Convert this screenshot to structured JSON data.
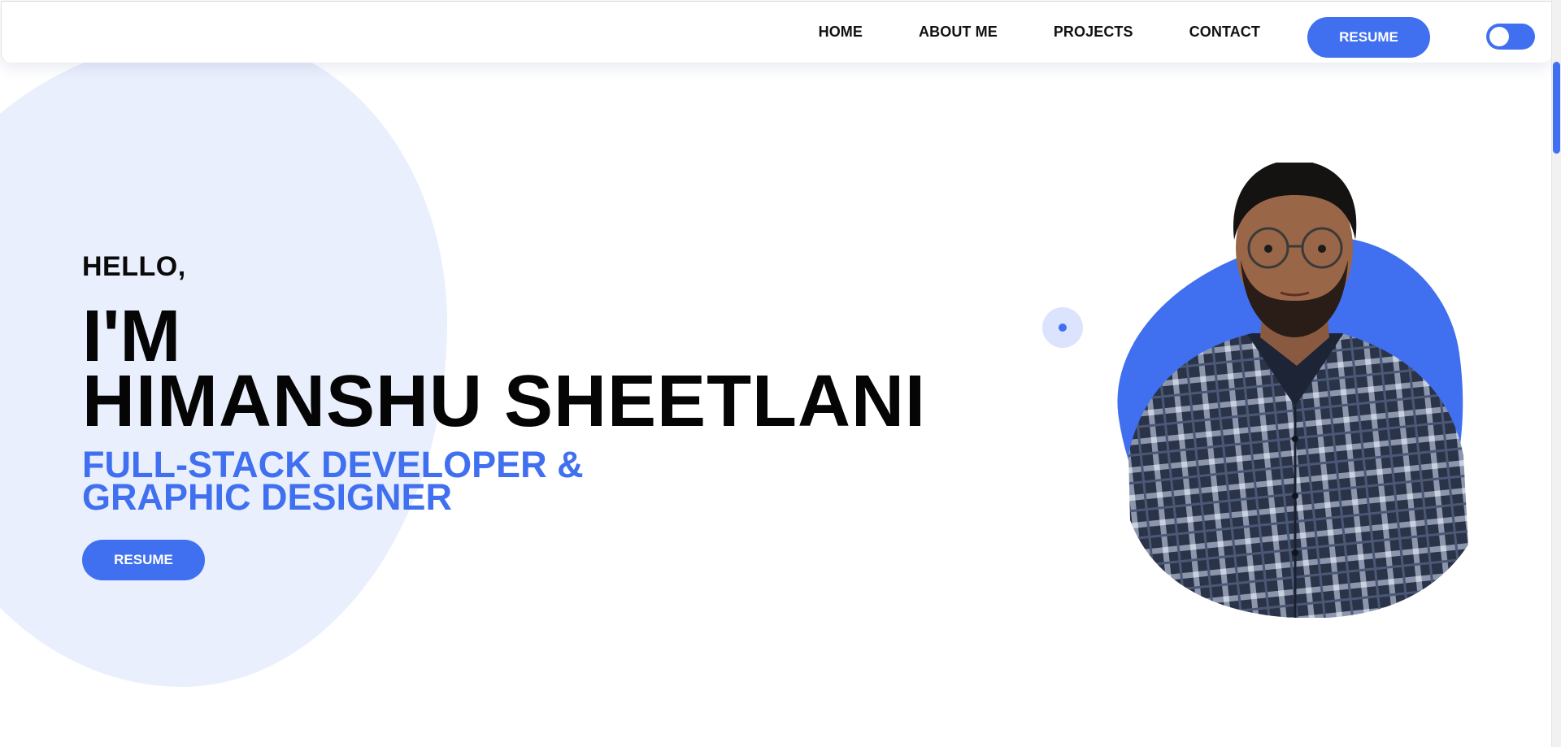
{
  "nav": {
    "links": [
      "HOME",
      "ABOUT ME",
      "PROJECTS",
      "CONTACT"
    ],
    "resume_label": "RESUME",
    "theme_toggle": "toggle-icon"
  },
  "hero": {
    "greeting": "HELLO,",
    "intro": "I'M",
    "name": "HIMANSHU SHEETLANI",
    "role_line1": "FULL-STACK DEVELOPER &",
    "role_line2": "GRAPHIC DESIGNER",
    "resume_label": "RESUME"
  },
  "colors": {
    "accent": "#4070f0",
    "blob": "#e9effc",
    "text": "#050505"
  },
  "portrait": {
    "icon": "person-photo"
  }
}
